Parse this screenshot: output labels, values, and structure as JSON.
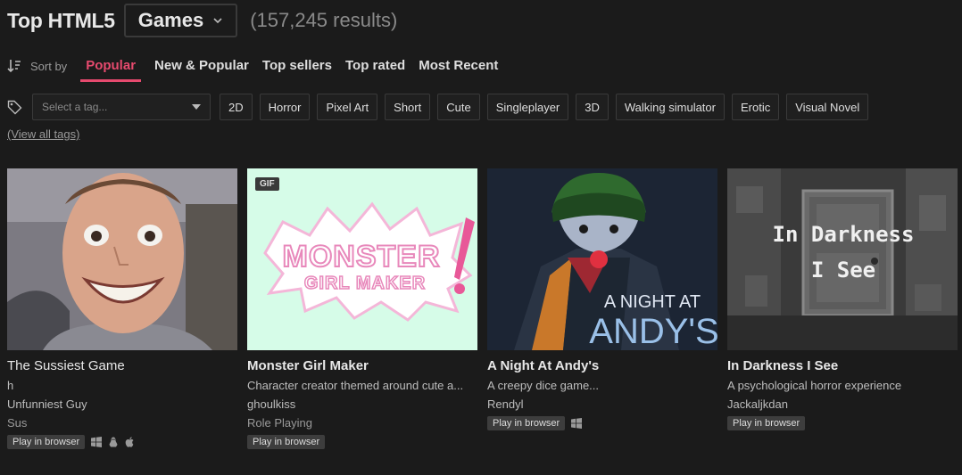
{
  "header": {
    "title": "Top HTML5",
    "dropdown": "Games",
    "results": "(157,245 results)"
  },
  "sort": {
    "label": "Sort by",
    "tabs": [
      "Popular",
      "New & Popular",
      "Top sellers",
      "Top rated",
      "Most Recent"
    ],
    "active": "Popular",
    "active_color": "#e64a6e"
  },
  "tags": {
    "placeholder": "Select a tag...",
    "items": [
      "2D",
      "Horror",
      "Pixel Art",
      "Short",
      "Cute",
      "Singleplayer",
      "3D",
      "Walking simulator",
      "Erotic",
      "Visual Novel"
    ],
    "view_all": "(View all tags)"
  },
  "games": [
    {
      "title": "The Sussiest Game",
      "lines": [
        "h",
        "Unfunniest Guy",
        "Sus"
      ],
      "badge": "Play in browser",
      "platforms": [
        "windows-icon",
        "linux-icon",
        "apple-icon"
      ]
    },
    {
      "gif": "GIF",
      "title": "Monster Girl Maker",
      "description": "Character creator themed around cute a...",
      "author": "ghoulkiss",
      "genre": "Role Playing",
      "badge": "Play in browser",
      "cover_text": [
        "MONSTER",
        "GIRL MAKER"
      ]
    },
    {
      "title": "A Night At Andy's",
      "description": "A creepy dice game...",
      "author": "Rendyl",
      "badge": "Play in browser",
      "platforms": [
        "windows-icon"
      ],
      "cover_text": [
        "A NIGHT AT",
        "ANDY'S"
      ]
    },
    {
      "title": "In Darkness I See",
      "description": "A psychological horror experience",
      "author": "Jackaljkdan",
      "badge": "Play in browser",
      "cover_text": [
        "In Darkness",
        "I See"
      ]
    }
  ]
}
